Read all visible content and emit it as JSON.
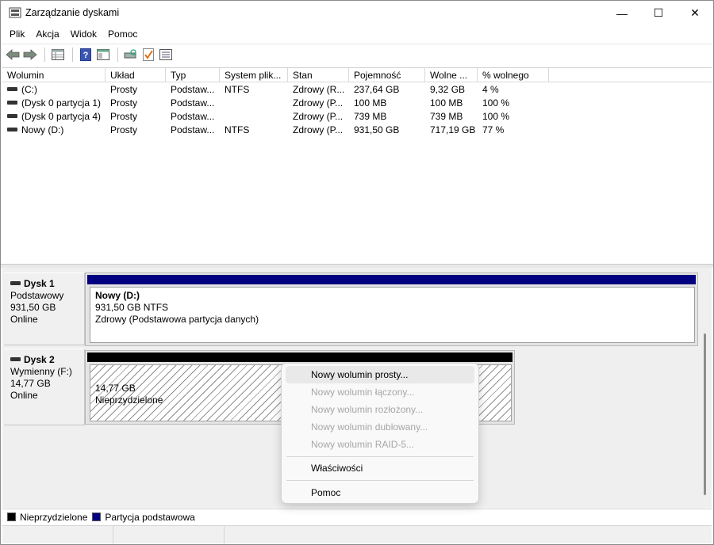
{
  "window": {
    "title": "Zarządzanie dyskami",
    "minimize_glyph": "—",
    "maximize_glyph": "☐",
    "close_glyph": "✕"
  },
  "menu": [
    "Plik",
    "Akcja",
    "Widok",
    "Pomoc"
  ],
  "toolbar": {
    "icons": [
      "back-arrow-icon",
      "forward-arrow-icon",
      "properties-grid-icon",
      "help-icon",
      "show-hide-pane-icon",
      "rescan-disks-icon",
      "checkmark-icon",
      "settings-list-icon"
    ]
  },
  "volume_list": {
    "columns": [
      "Wolumin",
      "Układ",
      "Typ",
      "System plik...",
      "Stan",
      "Pojemność",
      "Wolne ...",
      "% wolnego"
    ],
    "rows": [
      [
        "(C:)",
        "Prosty",
        "Podstaw...",
        "NTFS",
        "Zdrowy (R...",
        "237,64 GB",
        "9,32 GB",
        "4 %"
      ],
      [
        "(Dysk 0 partycja 1)",
        "Prosty",
        "Podstaw...",
        "",
        "Zdrowy (P...",
        "100 MB",
        "100 MB",
        "100 %"
      ],
      [
        "(Dysk 0 partycja 4)",
        "Prosty",
        "Podstaw...",
        "",
        "Zdrowy (P...",
        "739 MB",
        "739 MB",
        "100 %"
      ],
      [
        "Nowy (D:)",
        "Prosty",
        "Podstaw...",
        "NTFS",
        "Zdrowy (P...",
        "931,50 GB",
        "717,19 GB",
        "77 %"
      ]
    ]
  },
  "disks": [
    {
      "name": "Dysk 1",
      "type": "Podstawowy",
      "size": "931,50 GB",
      "status": "Online",
      "partition": {
        "name": "Nowy  (D:)",
        "detail": "931,50 GB NTFS",
        "state": "Zdrowy (Podstawowa partycja danych)"
      }
    },
    {
      "name": "Dysk 2",
      "type": "Wymienny (F:)",
      "size": "14,77 GB",
      "status": "Online",
      "partition": {
        "detail": "14,77 GB",
        "state": "Nieprzydzielone"
      }
    }
  ],
  "legend": [
    {
      "label": "Nieprzydzielone",
      "color": "#000000"
    },
    {
      "label": "Partycja podstawowa",
      "color": "#000080"
    }
  ],
  "context_menu": {
    "items": [
      {
        "label": "Nowy wolumin prosty...",
        "enabled": true
      },
      {
        "label": "Nowy wolumin łączony...",
        "enabled": false
      },
      {
        "label": "Nowy wolumin rozłożony...",
        "enabled": false
      },
      {
        "label": "Nowy wolumin dublowany...",
        "enabled": false
      },
      {
        "label": "Nowy wolumin RAID-5...",
        "enabled": false
      },
      {
        "label": "Właściwości",
        "enabled": true
      },
      {
        "label": "Pomoc",
        "enabled": true
      }
    ]
  },
  "colors": {
    "primary_partition": "#000080",
    "unallocated": "#000000"
  }
}
